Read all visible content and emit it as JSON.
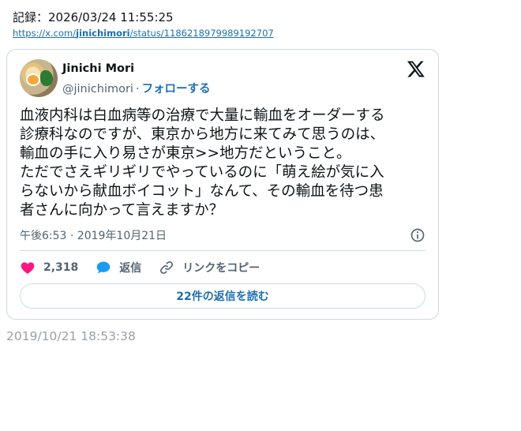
{
  "record": {
    "text": "記録：2026/03/24 11:55:25"
  },
  "link": {
    "prefix": "https://x.com/",
    "bold": "jinichimori",
    "suffix": "/status/1186218979989192707"
  },
  "tweet": {
    "author_name": "Jinichi Mori",
    "handle": "@jinichimori",
    "separator": "·",
    "follow_label": "フォローする",
    "body": "血液内科は白血病等の治療で大量に輸血をオーダーする\n診療科なのですが、東京から地方に来てみて思うのは、\n輸血の手に入り易さが東京>>地方だということ。\nただでさえギリギリでやっているのに「萌え絵が気に入\nらないから献血ボイコット」なんて、その輸血を待つ患\n者さんに向かって言えますか？",
    "timestamp": "午後6:53 · 2019年10月21日",
    "likes": "2,318",
    "reply_label": "返信",
    "copy_link_label": "リンクをコピー",
    "read_replies_label": "22件の返信を読む"
  },
  "archived_at": "2019/10/21 18:53:38",
  "colors": {
    "accent": "#1d6fb0",
    "like": "#f91880",
    "reply": "#1d9bf0",
    "muted": "#536471",
    "border": "#cfd9de"
  },
  "icons": {
    "logo": "x-logo-icon",
    "info": "info-icon",
    "like": "heart-icon",
    "reply": "speech-bubble-icon",
    "copy": "link-icon"
  }
}
